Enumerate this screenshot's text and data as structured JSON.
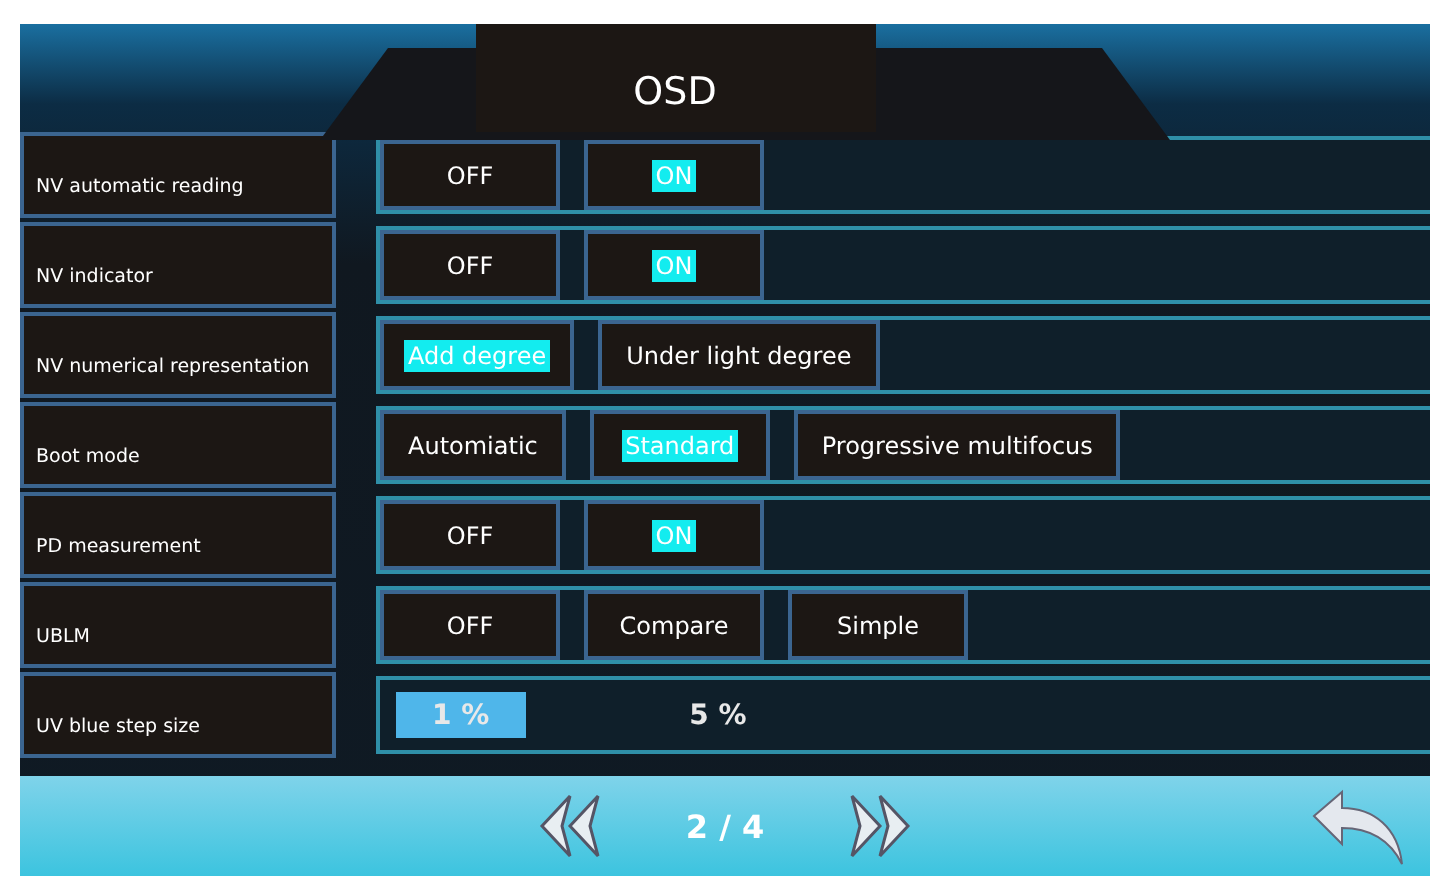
{
  "title": "OSD",
  "settings": [
    {
      "label": "NV automatic reading",
      "options": [
        {
          "text": "OFF",
          "selected": false
        },
        {
          "text": "ON",
          "selected": true
        }
      ]
    },
    {
      "label": "NV indicator",
      "options": [
        {
          "text": "OFF",
          "selected": false
        },
        {
          "text": "ON",
          "selected": true
        }
      ]
    },
    {
      "label": "NV numerical representation",
      "options": [
        {
          "text": "Add degree",
          "selected": true
        },
        {
          "text": "Under light degree",
          "selected": false
        }
      ]
    },
    {
      "label": "Boot mode",
      "options": [
        {
          "text": "Automiatic",
          "selected": false
        },
        {
          "text": "Standard",
          "selected": true
        },
        {
          "text": "Progressive multifocus",
          "selected": false
        }
      ]
    },
    {
      "label": "PD measurement",
      "options": [
        {
          "text": "OFF",
          "selected": false
        },
        {
          "text": "ON",
          "selected": true
        }
      ]
    },
    {
      "label": "UBLM",
      "options": [
        {
          "text": "OFF",
          "selected": false
        },
        {
          "text": "Compare",
          "selected": false
        },
        {
          "text": "Simple",
          "selected": false
        }
      ]
    },
    {
      "label": "UV blue step size",
      "kind": "steps",
      "options": [
        {
          "text": "1 %",
          "selected": true
        },
        {
          "text": "5 %",
          "selected": false
        }
      ]
    }
  ],
  "page": "2 / 4"
}
